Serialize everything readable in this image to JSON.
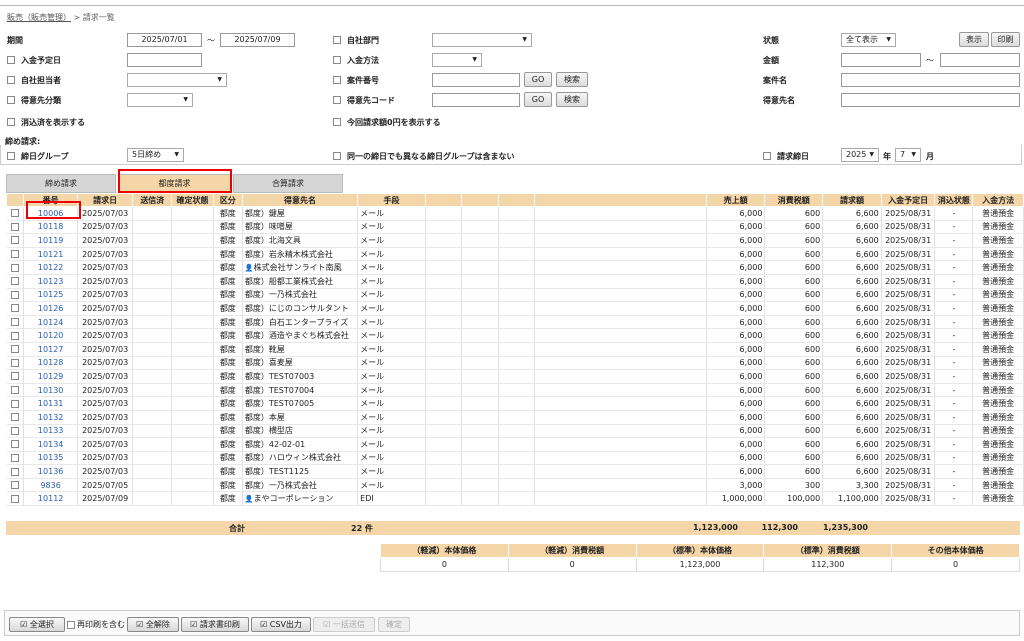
{
  "breadcrumb": {
    "link": "販売（販売管理）",
    "sep": ">",
    "current": "請求一覧"
  },
  "filters": {
    "period_label": "期間",
    "period_from": "2025/07/01",
    "tilde": "〜",
    "period_to": "2025/07/09",
    "own_dept_label": "自社部門",
    "status_label": "状態",
    "status_value": "全て表示",
    "show_button": "表示",
    "print_button": "印刷",
    "due_date_label": "入金予定日",
    "pay_method_label": "入金方法",
    "amount_label": "金額",
    "amount_tilde": "〜",
    "owner_label": "自社担当者",
    "case_no_label": "案件番号",
    "go1": "GO",
    "search1": "検索",
    "case_name_label": "案件名",
    "client_class_label": "得意先分類",
    "client_code_label": "得意先コード",
    "go2": "GO",
    "search2": "検索",
    "client_name_label": "得意先名",
    "cleared_label": "消込済を表示する",
    "zero_label": "今回請求額0円を表示する",
    "closing_title": "締め請求:",
    "closing_group_label": "締日グループ",
    "closing_group_value": "5日締め",
    "same_day_label": "同一の締日でも異なる締日グループは含まない",
    "bill_close_label": "請求締日",
    "year_value": "2025",
    "year_unit": "年",
    "month_value": "7",
    "month_unit": "月"
  },
  "tabs": [
    "締め請求",
    "都度請求",
    "合算請求"
  ],
  "columns": [
    "",
    "番号",
    "請求日",
    "送信済",
    "確定状態",
    "区分",
    "得意先名",
    "手段",
    "",
    "",
    "",
    "",
    "売上額",
    "消費税額",
    "請求額",
    "入金予定日",
    "消込状態",
    "入金方法"
  ],
  "rows": [
    {
      "no": "10006",
      "date": "2025/07/03",
      "kubun": "都度",
      "client": "都度）鍵屋",
      "method": "メール",
      "sales": "6,000",
      "tax": "600",
      "bill": "6,600",
      "due": "2025/08/31",
      "clear": "-",
      "pay": "普通預金"
    },
    {
      "no": "10118",
      "date": "2025/07/03",
      "kubun": "都度",
      "client": "都度）味噌屋",
      "method": "メール",
      "sales": "6,000",
      "tax": "600",
      "bill": "6,600",
      "due": "2025/08/31",
      "clear": "-",
      "pay": "普通預金"
    },
    {
      "no": "10119",
      "date": "2025/07/03",
      "kubun": "都度",
      "client": "都度）北海文具",
      "method": "メール",
      "sales": "6,000",
      "tax": "600",
      "bill": "6,600",
      "due": "2025/08/31",
      "clear": "-",
      "pay": "普通預金"
    },
    {
      "no": "10121",
      "date": "2025/07/03",
      "kubun": "都度",
      "client": "都度）岩永精木株式会社",
      "method": "メール",
      "sales": "6,000",
      "tax": "600",
      "bill": "6,600",
      "due": "2025/08/31",
      "clear": "-",
      "pay": "普通預金"
    },
    {
      "no": "10122",
      "date": "2025/07/03",
      "kubun": "都度",
      "client": "株式会社サンライト南風",
      "method": "メール",
      "sales": "6,000",
      "tax": "600",
      "bill": "6,600",
      "due": "2025/08/31",
      "clear": "-",
      "pay": "普通預金"
    },
    {
      "no": "10123",
      "date": "2025/07/03",
      "kubun": "都度",
      "client": "都度）船都工業株式会社",
      "method": "メール",
      "sales": "6,000",
      "tax": "600",
      "bill": "6,600",
      "due": "2025/08/31",
      "clear": "-",
      "pay": "普通預金"
    },
    {
      "no": "10125",
      "date": "2025/07/03",
      "kubun": "都度",
      "client": "都度）一乃株式会社",
      "method": "メール",
      "sales": "6,000",
      "tax": "600",
      "bill": "6,600",
      "due": "2025/08/31",
      "clear": "-",
      "pay": "普通預金"
    },
    {
      "no": "10126",
      "date": "2025/07/03",
      "kubun": "都度",
      "client": "都度）にじのコンサルタント",
      "method": "メール",
      "sales": "6,000",
      "tax": "600",
      "bill": "6,600",
      "due": "2025/08/31",
      "clear": "-",
      "pay": "普通預金"
    },
    {
      "no": "10124",
      "date": "2025/07/03",
      "kubun": "都度",
      "client": "都度）白石エンタープライズ",
      "method": "メール",
      "sales": "6,000",
      "tax": "600",
      "bill": "6,600",
      "due": "2025/08/31",
      "clear": "-",
      "pay": "普通預金"
    },
    {
      "no": "10120",
      "date": "2025/07/03",
      "kubun": "都度",
      "client": "都度）酒造やまぐち株式会社",
      "method": "メール",
      "sales": "6,000",
      "tax": "600",
      "bill": "6,600",
      "due": "2025/08/31",
      "clear": "-",
      "pay": "普通預金"
    },
    {
      "no": "10127",
      "date": "2025/07/03",
      "kubun": "都度",
      "client": "都度）靴屋",
      "method": "メール",
      "sales": "6,000",
      "tax": "600",
      "bill": "6,600",
      "due": "2025/08/31",
      "clear": "-",
      "pay": "普通預金"
    },
    {
      "no": "10128",
      "date": "2025/07/03",
      "kubun": "都度",
      "client": "都度）喜麦屋",
      "method": "メール",
      "sales": "6,000",
      "tax": "600",
      "bill": "6,600",
      "due": "2025/08/31",
      "clear": "-",
      "pay": "普通預金"
    },
    {
      "no": "10129",
      "date": "2025/07/03",
      "kubun": "都度",
      "client": "都度）TEST07003",
      "method": "メール",
      "sales": "6,000",
      "tax": "600",
      "bill": "6,600",
      "due": "2025/08/31",
      "clear": "-",
      "pay": "普通預金"
    },
    {
      "no": "10130",
      "date": "2025/07/03",
      "kubun": "都度",
      "client": "都度）TEST07004",
      "method": "メール",
      "sales": "6,000",
      "tax": "600",
      "bill": "6,600",
      "due": "2025/08/31",
      "clear": "-",
      "pay": "普通預金"
    },
    {
      "no": "10131",
      "date": "2025/07/03",
      "kubun": "都度",
      "client": "都度）TEST07005",
      "method": "メール",
      "sales": "6,000",
      "tax": "600",
      "bill": "6,600",
      "due": "2025/08/31",
      "clear": "-",
      "pay": "普通預金"
    },
    {
      "no": "10132",
      "date": "2025/07/03",
      "kubun": "都度",
      "client": "都度）本屋",
      "method": "メール",
      "sales": "6,000",
      "tax": "600",
      "bill": "6,600",
      "due": "2025/08/31",
      "clear": "-",
      "pay": "普通預金"
    },
    {
      "no": "10133",
      "date": "2025/07/03",
      "kubun": "都度",
      "client": "都度）横型店",
      "method": "メール",
      "sales": "6,000",
      "tax": "600",
      "bill": "6,600",
      "due": "2025/08/31",
      "clear": "-",
      "pay": "普通預金"
    },
    {
      "no": "10134",
      "date": "2025/07/03",
      "kubun": "都度",
      "client": "都度）42-02-01",
      "method": "メール",
      "sales": "6,000",
      "tax": "600",
      "bill": "6,600",
      "due": "2025/08/31",
      "clear": "-",
      "pay": "普通預金"
    },
    {
      "no": "10135",
      "date": "2025/07/03",
      "kubun": "都度",
      "client": "都度）ハロウィン株式会社",
      "method": "メール",
      "sales": "6,000",
      "tax": "600",
      "bill": "6,600",
      "due": "2025/08/31",
      "clear": "-",
      "pay": "普通預金"
    },
    {
      "no": "10136",
      "date": "2025/07/03",
      "kubun": "都度",
      "client": "都度）TEST1125",
      "method": "メール",
      "sales": "6,000",
      "tax": "600",
      "bill": "6,600",
      "due": "2025/08/31",
      "clear": "-",
      "pay": "普通預金"
    },
    {
      "no": "9836",
      "date": "2025/07/05",
      "kubun": "都度",
      "client": "都度）一乃株式会社",
      "method": "メール",
      "sales": "3,000",
      "tax": "300",
      "bill": "3,300",
      "due": "2025/08/31",
      "clear": "-",
      "pay": "普通預金"
    },
    {
      "no": "10112",
      "date": "2025/07/09",
      "kubun": "都度",
      "client": "まやコーポレーション",
      "method": "EDI",
      "sales": "1,000,000",
      "tax": "100,000",
      "bill": "1,100,000",
      "due": "2025/08/31",
      "clear": "-",
      "pay": "普通預金"
    }
  ],
  "summary": {
    "label": "合計",
    "count": "22 件",
    "sales": "1,123,000",
    "tax": "112,300",
    "bill": "1,235,300"
  },
  "tax_table": {
    "headers": [
      "（軽減）本体価格",
      "（軽減）消費税額",
      "（標準）本体価格",
      "（標準）消費税額",
      "その他本体価格"
    ],
    "values": [
      "0",
      "0",
      "1,123,000",
      "112,300",
      "0"
    ]
  },
  "footer": {
    "select_all": "全選択",
    "reprint": "再印刷を含む",
    "clear_all": "全解除",
    "print_invoice": "請求書印刷",
    "csv": "CSV出力",
    "bulk_send": "一括送信",
    "confirm": "確定"
  }
}
